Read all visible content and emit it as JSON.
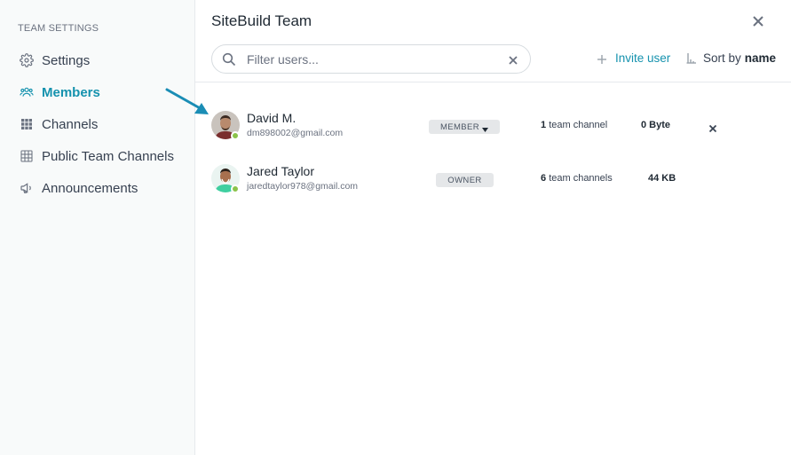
{
  "sidebar": {
    "heading": "TEAM SETTINGS",
    "items": [
      {
        "label": "Settings",
        "icon": "gear-icon",
        "active": false
      },
      {
        "label": "Members",
        "icon": "users-icon",
        "active": true
      },
      {
        "label": "Channels",
        "icon": "grid-icon",
        "active": false
      },
      {
        "label": "Public Team Channels",
        "icon": "table-icon",
        "active": false
      },
      {
        "label": "Announcements",
        "icon": "megaphone-icon",
        "active": false
      }
    ]
  },
  "header": {
    "title": "SiteBuild Team",
    "close_icon": "close-icon"
  },
  "search": {
    "placeholder": "Filter users...",
    "value": ""
  },
  "toolbar": {
    "invite_label": "Invite user",
    "sort_label": "Sort by",
    "sort_value": "name"
  },
  "members": [
    {
      "name": "David M.",
      "email": "dm898002@gmail.com",
      "role": "MEMBER",
      "role_has_dropdown": true,
      "channels_count": "1",
      "channels_label": "team channel",
      "size": "0 Byte",
      "removable": true,
      "online": true
    },
    {
      "name": "Jared Taylor",
      "email": "jaredtaylor978@gmail.com",
      "role": "OWNER",
      "role_has_dropdown": false,
      "channels_count": "6",
      "channels_label": "team channels",
      "size": "44 KB",
      "removable": false,
      "online": true
    }
  ],
  "colors": {
    "accent": "#1592ae",
    "presence": "#8bc34a",
    "badge_bg": "#e5e7e9",
    "annotation_arrow": "#1a8db5"
  }
}
